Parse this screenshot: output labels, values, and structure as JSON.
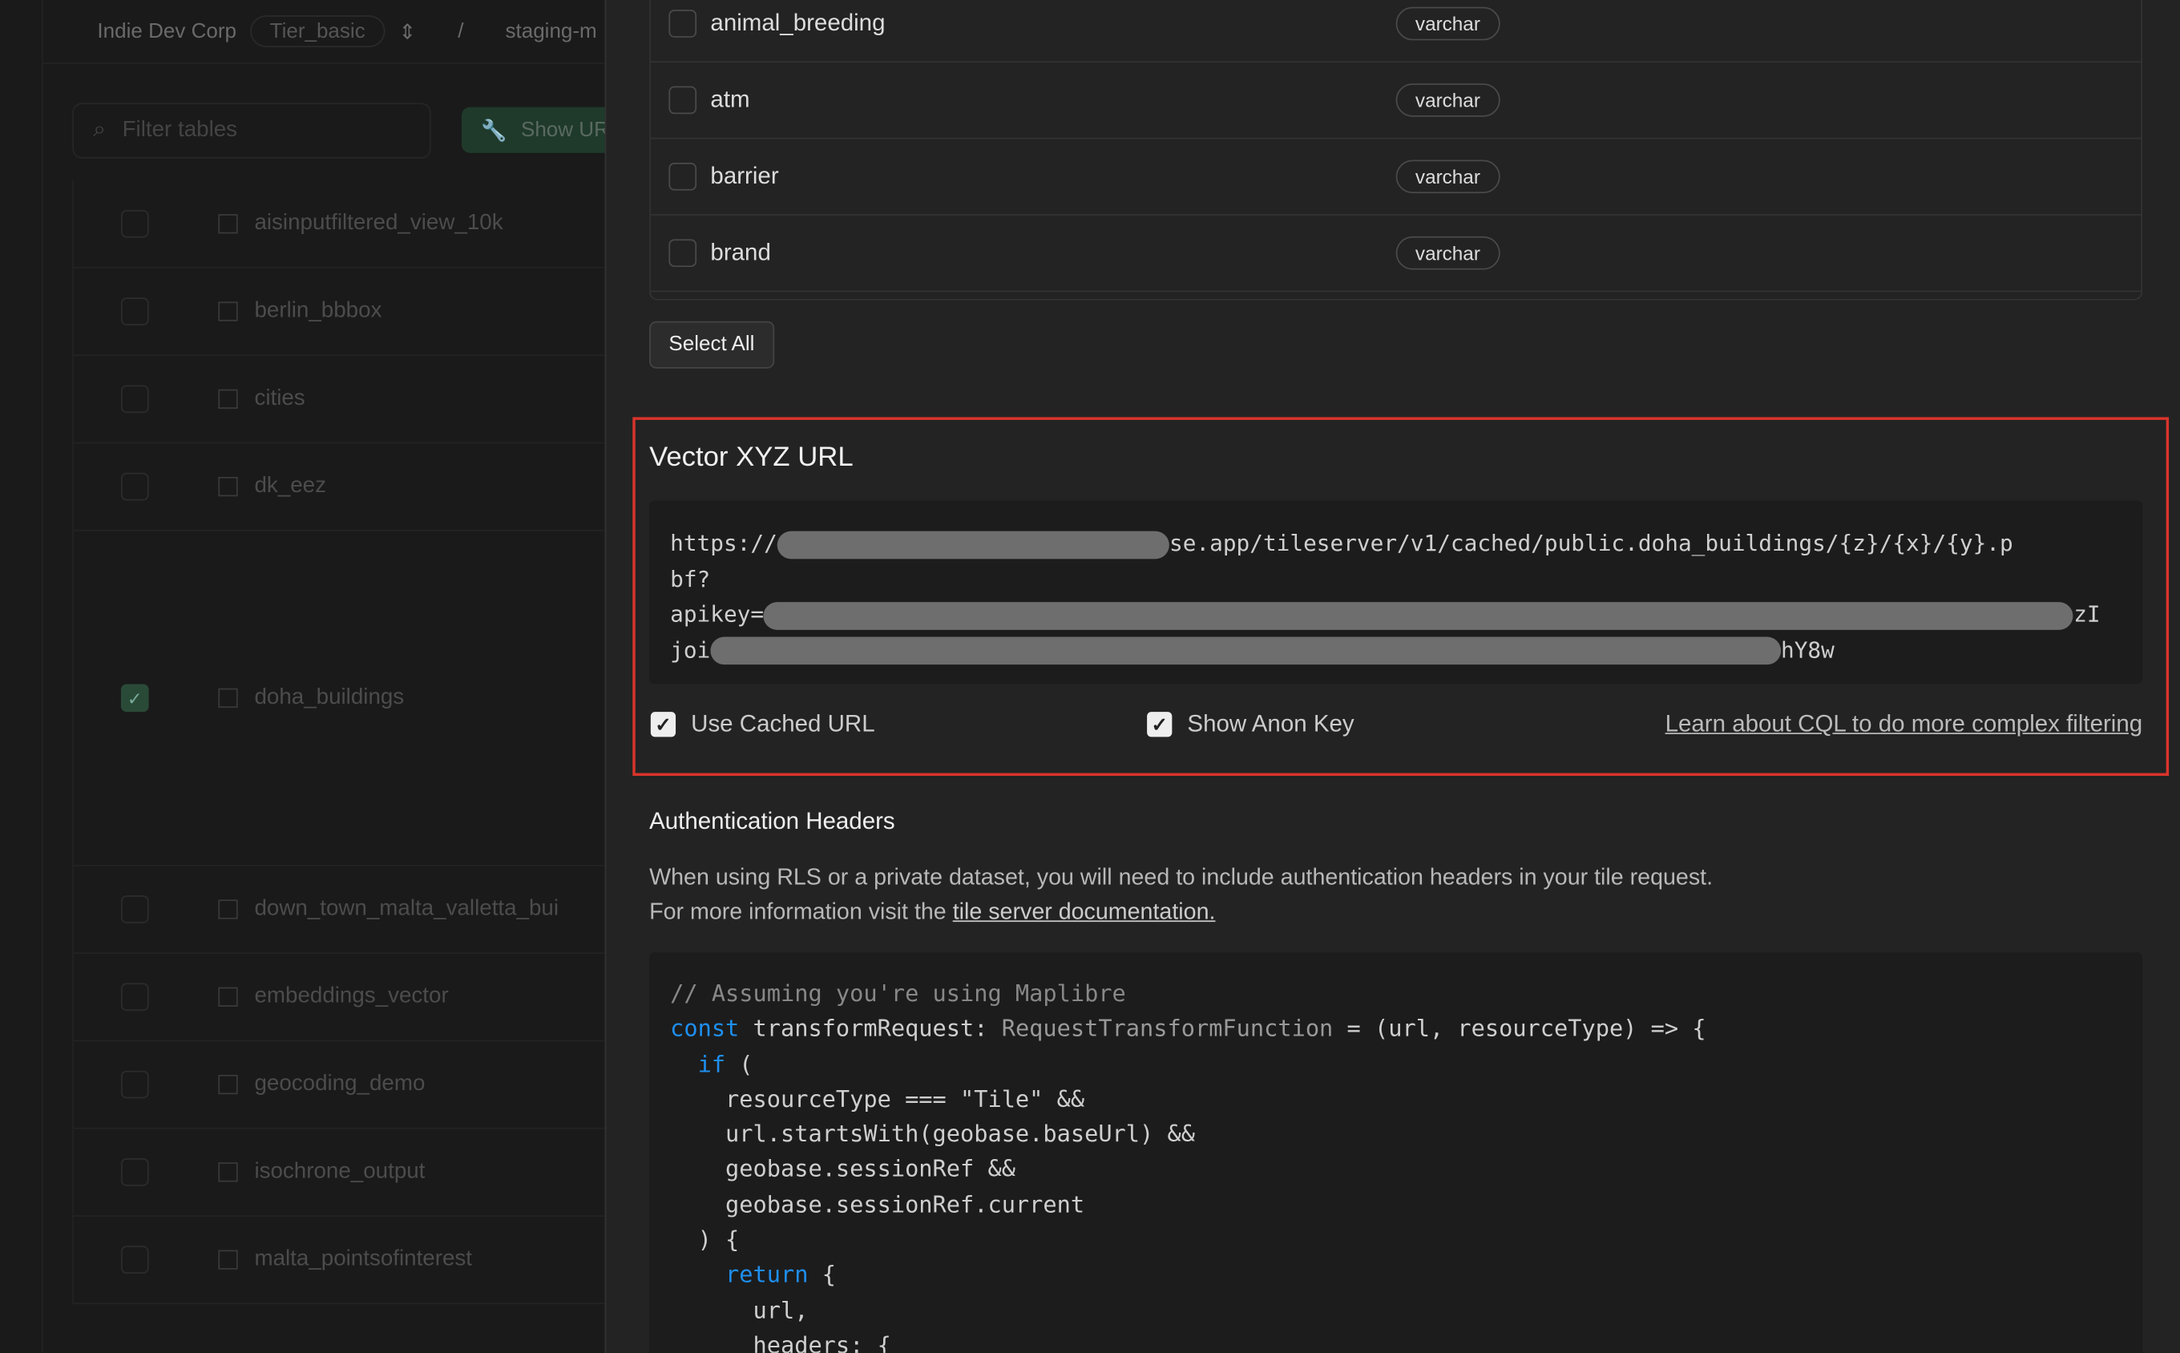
{
  "header": {
    "org": "Indie Dev Corp",
    "tier": "Tier_basic",
    "project": "staging-m"
  },
  "sidebar": {
    "filter_placeholder": "Filter tables",
    "show_url_label": "Show UR",
    "tables": [
      {
        "name": "aisinputfiltered_view_10k",
        "checked": false
      },
      {
        "name": "berlin_bbbox",
        "checked": false
      },
      {
        "name": "cities",
        "checked": false
      },
      {
        "name": "dk_eez",
        "checked": false
      },
      {
        "name": "doha_buildings",
        "checked": true
      },
      {
        "name": "down_town_malta_valletta_bui",
        "checked": false
      },
      {
        "name": "embeddings_vector",
        "checked": false
      },
      {
        "name": "geocoding_demo",
        "checked": false
      },
      {
        "name": "isochrone_output",
        "checked": false
      },
      {
        "name": "malta_pointsofinterest",
        "checked": false
      }
    ]
  },
  "columns": [
    {
      "name": "animal_breeding",
      "type": "varchar"
    },
    {
      "name": "atm",
      "type": "varchar"
    },
    {
      "name": "barrier",
      "type": "varchar"
    },
    {
      "name": "brand",
      "type": "varchar"
    }
  ],
  "select_all": "Select All",
  "vector": {
    "title": "Vector XYZ URL",
    "url_prefix": "https://",
    "url_rest": "se.app/tileserver/v1/cached/public.doha_buildings/{z}/{x}/{y}.p",
    "url_line2": "bf?",
    "apikey_prefix": "apikey=",
    "apikey_tail": "zI",
    "line4_prefix": "joi",
    "line4_tail": "hY8w",
    "use_cached": "Use Cached URL",
    "show_anon": "Show Anon Key",
    "learn_link": "Learn about CQL to do more complex filtering"
  },
  "auth": {
    "title": "Authentication Headers",
    "desc1": "When using RLS or a private dataset, you will need to include authentication headers in your tile request.",
    "desc2": "For more information visit the ",
    "doc_link": "tile server documentation."
  },
  "code": {
    "l1": "// Assuming you're using Maplibre",
    "l2a": "const",
    "l2b": " transformRequest: ",
    "l2c": "RequestTransformFunction",
    "l2d": " = (url, resourceType) => {",
    "l3a": "  if",
    "l3b": " (",
    "l4": "    resourceType === \"Tile\" &&",
    "l5": "    url.startsWith(geobase.baseUrl) &&",
    "l6": "    geobase.sessionRef &&",
    "l7": "    geobase.sessionRef.current",
    "l8": "  ) {",
    "l9a": "    return",
    "l9b": " {",
    "l10": "      url,",
    "l11": "      headers: {"
  }
}
